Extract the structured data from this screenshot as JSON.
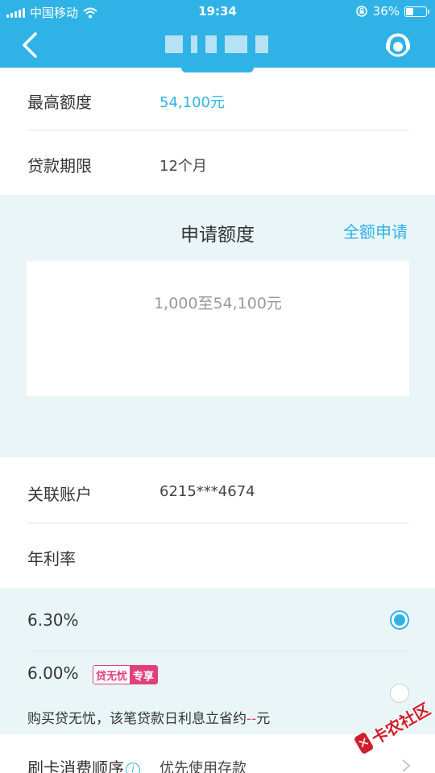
{
  "status_bar": {
    "carrier": "中国移动",
    "time": "19:34",
    "battery": "36%",
    "battery_level": 0.36
  },
  "nav": {
    "back_icon": "chevron-left-icon",
    "support_icon": "customer-service-icon"
  },
  "info": {
    "max_limit_label": "最高额度",
    "max_limit_value": "54,100元",
    "term_label": "贷款期限",
    "term_value": "12个月"
  },
  "apply": {
    "title": "申请额度",
    "full_amount_link": "全额申请",
    "amount_placeholder": "1,000至54,100元"
  },
  "account": {
    "label": "关联账户",
    "value": "6215***4674"
  },
  "rate": {
    "label": "年利率",
    "options": [
      {
        "rate": "6.30%",
        "selected": true
      },
      {
        "rate": "6.00%",
        "selected": false,
        "badge_part1": "贷无忧",
        "badge_part2": "专享"
      }
    ],
    "note_prefix": "购买贷无忧，该笔贷款日利息立省约",
    "note_amount": "--",
    "note_suffix": "元"
  },
  "payment_order": {
    "label": "刷卡消费顺序",
    "value": "优先使用存款"
  },
  "watermark": {
    "text": "卡农社区"
  },
  "colors": {
    "primary": "#2fb3e6",
    "badge": "#e0407a",
    "section_bg": "#eaf5f8"
  }
}
